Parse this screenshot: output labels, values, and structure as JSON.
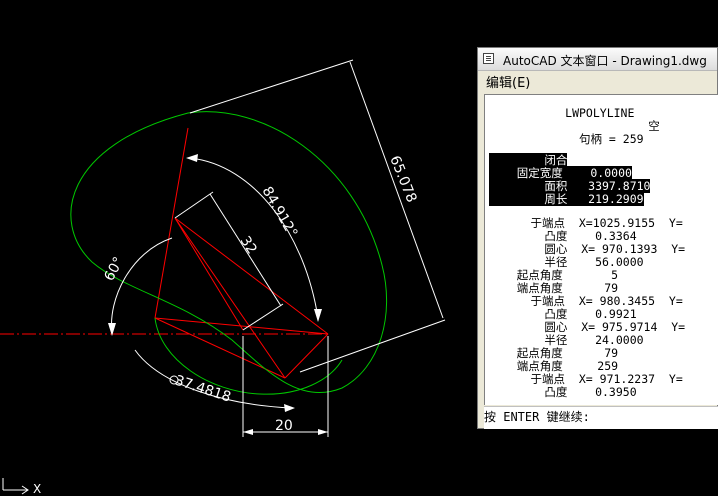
{
  "drawing": {
    "dimensions": {
      "angle_large": "84.912°",
      "length_32": "32",
      "aligned_65": "65.078",
      "angle_60": "60°",
      "radius_37": "37.4818",
      "linear_20": "20"
    },
    "ucs_axis_label": "X"
  },
  "text_window": {
    "title": "AutoCAD 文本窗口 - Drawing1.dwg",
    "menu": {
      "edit_label": "编辑(E)"
    },
    "lines": [
      "           LWPOLYLINE",
      "                       空",
      "             句柄 = 259",
      "",
      "        闭合",
      "    固定宽度    0.0000",
      "        面积   3397.8710",
      "        周长   219.2909",
      "",
      "      于端点  X=1025.9155  Y=",
      "        凸度    0.3364",
      "        圆心  X= 970.1393  Y=",
      "        半径    56.0000",
      "    起点角度       5",
      "    端点角度      79",
      "      于端点  X= 980.3455  Y=",
      "        凸度    0.9921",
      "        圆心  X= 975.9714  Y=",
      "        半径    24.0000",
      "    起点角度      79",
      "    端点角度     259",
      "      于端点  X= 971.2237  Y=",
      "        凸度    0.3950"
    ],
    "prompt": "按 ENTER 键继续:"
  }
}
